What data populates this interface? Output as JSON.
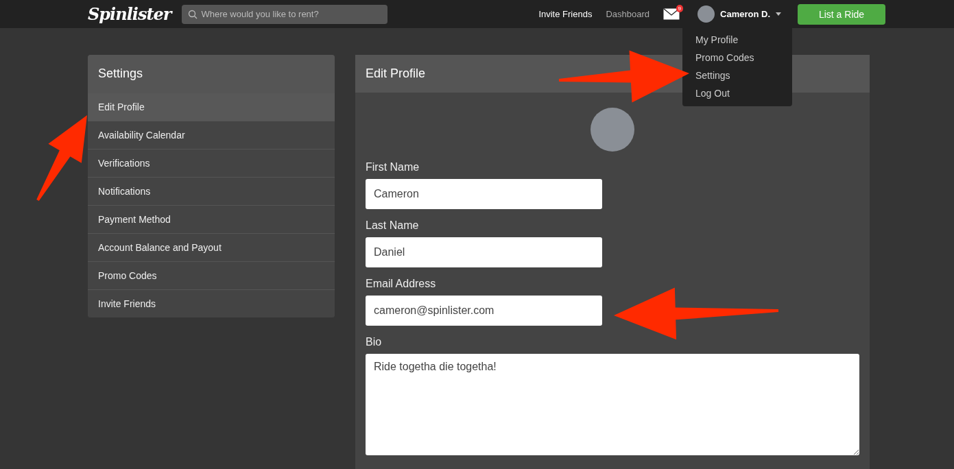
{
  "header": {
    "logo": "Spinlister",
    "search": {
      "placeholder": "Where would you like to rent?"
    },
    "links": [
      {
        "label": "Invite Friends",
        "kind": "primary"
      },
      {
        "label": "Dashboard",
        "kind": "muted"
      }
    ],
    "messages_badge": "9",
    "user": {
      "name": "Cameron D."
    },
    "cta": "List a Ride"
  },
  "user_menu": {
    "items": [
      {
        "label": "My Profile"
      },
      {
        "label": "Promo Codes"
      },
      {
        "label": "Settings"
      },
      {
        "label": "Log Out"
      }
    ]
  },
  "sidebar": {
    "title": "Settings",
    "items": [
      {
        "label": "Edit Profile",
        "selected": true
      },
      {
        "label": "Availability Calendar",
        "selected": false
      },
      {
        "label": "Verifications",
        "selected": false
      },
      {
        "label": "Notifications",
        "selected": false
      },
      {
        "label": "Payment Method",
        "selected": false
      },
      {
        "label": "Account Balance and Payout",
        "selected": false
      },
      {
        "label": "Promo Codes",
        "selected": false
      },
      {
        "label": "Invite Friends",
        "selected": false
      }
    ]
  },
  "profile": {
    "title": "Edit Profile",
    "fields": [
      {
        "label": "First Name",
        "value": "Cameron",
        "kind": "input"
      },
      {
        "label": "Last Name",
        "value": "Daniel",
        "kind": "input"
      },
      {
        "label": "Email Address",
        "value": "cameron@spinlister.com",
        "kind": "input"
      },
      {
        "label": "Bio",
        "value": "Ride togetha die togetha!",
        "kind": "textarea"
      }
    ]
  }
}
